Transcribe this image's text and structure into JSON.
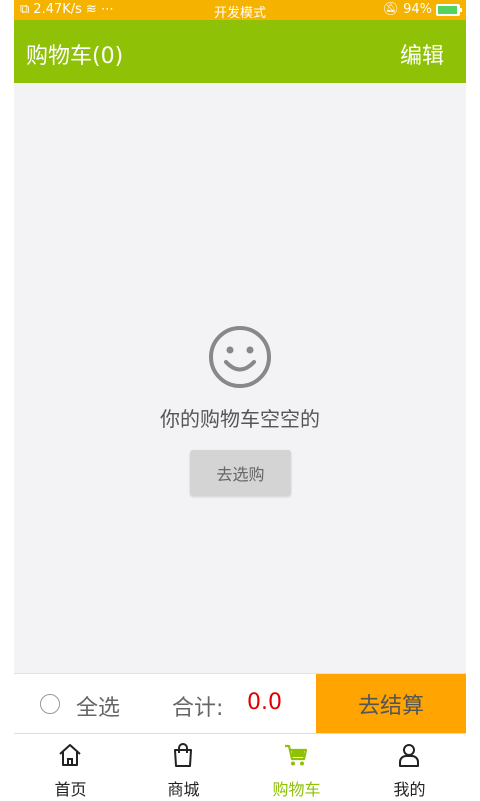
{
  "status_bar": {
    "network": "2.47K/s",
    "center": "开发模式",
    "battery": "94%",
    "battery_level": 0.94
  },
  "header": {
    "title": "购物车(0)",
    "edit": "编辑"
  },
  "empty_state": {
    "message": "你的购物车空空的",
    "button": "去选购"
  },
  "checkout": {
    "select_all": "全选",
    "total_label": "合计:",
    "total_value": "0.0",
    "checkout_button": "去结算"
  },
  "tabs": [
    {
      "label": "首页",
      "icon": "home-icon"
    },
    {
      "label": "商城",
      "icon": "shopping-bag-icon"
    },
    {
      "label": "购物车",
      "icon": "cart-icon",
      "active": true
    },
    {
      "label": "我的",
      "icon": "user-icon"
    }
  ],
  "colors": {
    "status": "#f5b300",
    "header": "#8fc107",
    "accent": "#ffa400",
    "price": "#e10000"
  }
}
